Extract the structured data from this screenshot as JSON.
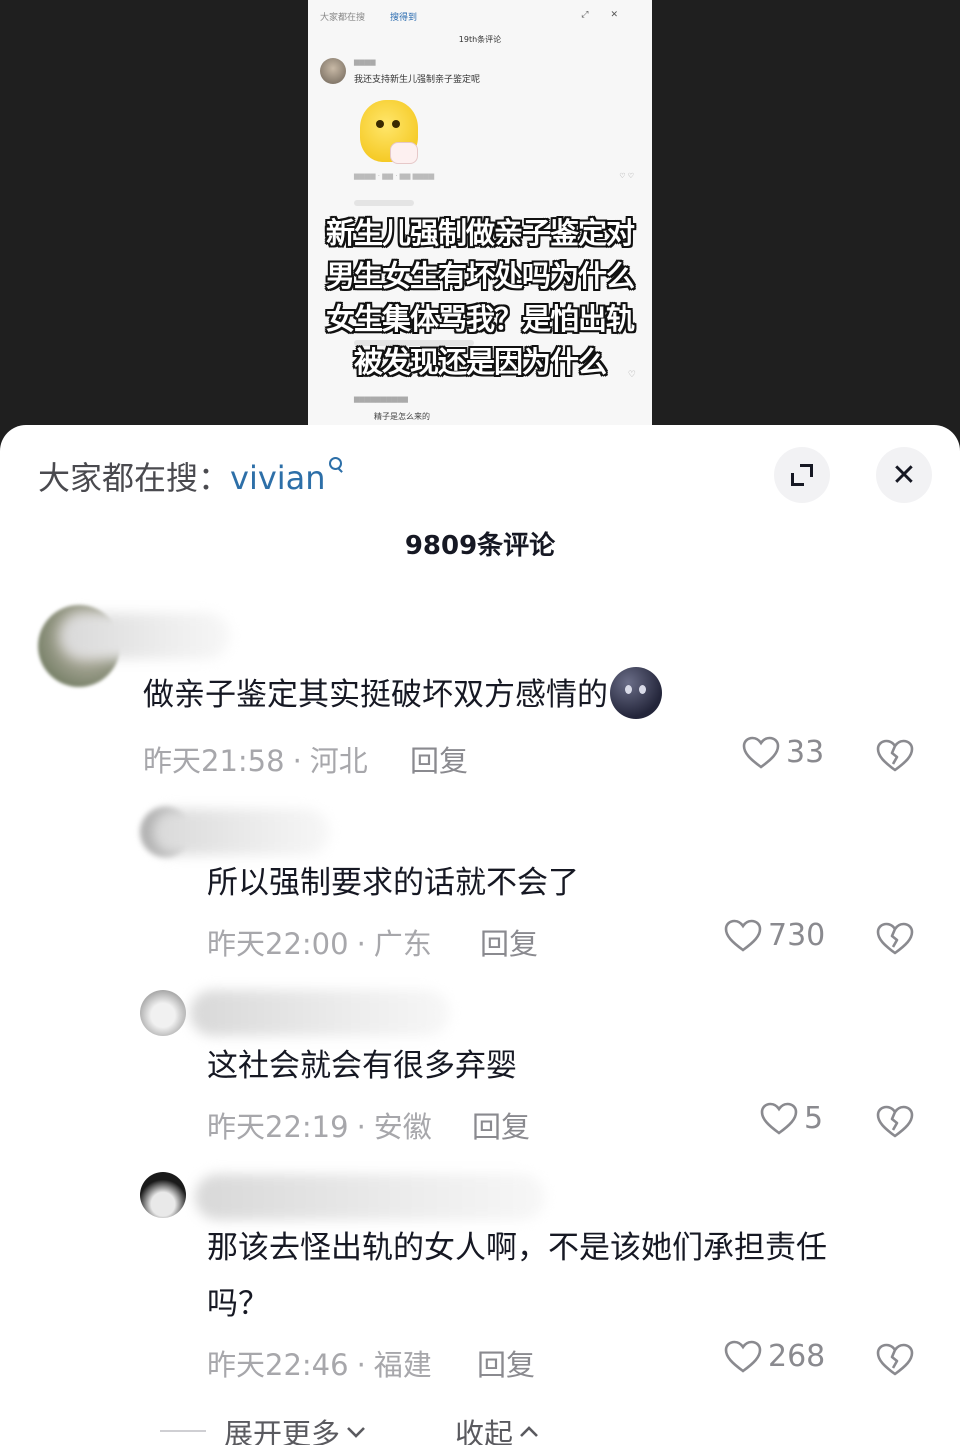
{
  "video": {
    "thumbnail": {
      "top_title": "大家都在搜",
      "top_search": "搜得到",
      "count": "19th条评论",
      "main_text": "我还支持新生儿强制亲子鉴定呢",
      "foot_text": "精子是怎么来的"
    },
    "caption_lines": [
      "新生儿强制做亲子鉴定对",
      "男生女生有坏处吗为什么",
      "女生集体骂我？是怕出轨",
      "被发现还是因为什么"
    ]
  },
  "panel": {
    "search_prefix": "大家都在搜：",
    "search_keyword": "vivian",
    "comment_count": "9809条评论",
    "comments": [
      {
        "text": "做亲子鉴定其实挺破坏双方感情的",
        "emoji": "dark-face-emoji",
        "time": "昨天21:58",
        "region": "河北",
        "reply": "回复",
        "likes": "33"
      },
      {
        "text": "所以强制要求的话就不会了",
        "time": "昨天22:00",
        "region": "广东",
        "reply": "回复",
        "likes": "730"
      },
      {
        "text": "这社会就会有很多弃婴",
        "time": "昨天22:19",
        "region": "安徽",
        "reply": "回复",
        "likes": "5"
      },
      {
        "text_line1": "那该去怪出轨的女人啊，不是该她们承担责任",
        "text_line2": "吗？",
        "time": "昨天22:46",
        "region": "福建",
        "reply": "回复",
        "likes": "268"
      }
    ],
    "expand_more": "展开更多",
    "collapse": "收起",
    "separator": "·"
  },
  "icons": {
    "expand": "expand-icon",
    "close": "close-icon",
    "like": "heart-icon",
    "dislike": "broken-heart-icon",
    "search_small": "search-icon",
    "chevron_down": "chevron-down-icon",
    "chevron_up": "chevron-up-icon"
  },
  "colors": {
    "keyword": "#2d6fa8",
    "text": "#161823",
    "meta": "#a7a7ab",
    "background_dark": "#1e1e1e"
  }
}
